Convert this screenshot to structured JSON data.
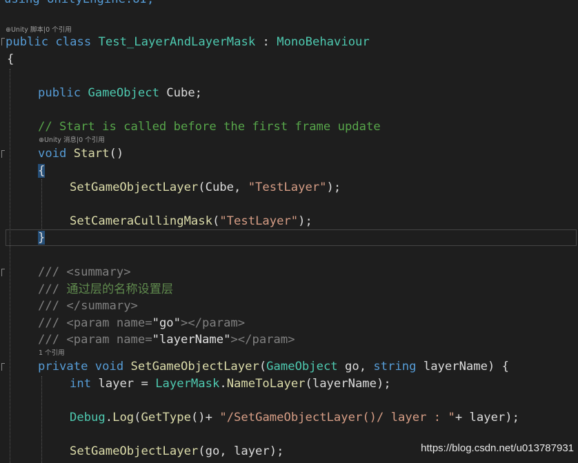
{
  "code": {
    "l0": "using UnityEngine.UI;",
    "lens_class": "Unity 脚本|0 个引用",
    "class_kw": "public class ",
    "class_name": "Test_LayerAndLayerMask",
    "class_colon": " : ",
    "base_class": "MonoBehaviour",
    "open_brace": "{",
    "field_kw": "public ",
    "field_type": "GameObject",
    "field_name": " Cube;",
    "comment_start": "// Start is called before the first frame update",
    "lens_start": "Unity 消息|0 个引用",
    "start_void": "void ",
    "start_name": "Start",
    "start_parens": "()",
    "start_open": "{",
    "call1_fn": "SetGameObjectLayer",
    "call1_a": "(Cube, ",
    "call1_str": "\"TestLayer\"",
    "call1_end": ");",
    "call2_fn": "SetCameraCullingMask",
    "call2_a": "(",
    "call2_str": "\"TestLayer\"",
    "call2_end": ");",
    "start_close": "}",
    "doc1_slashes": "/// ",
    "doc1_tag": "<summary>",
    "doc2_slashes": "/// ",
    "doc2_text": "通过层的名称设置层",
    "doc3_slashes": "/// ",
    "doc3_tag": "</summary>",
    "doc4_slashes": "/// ",
    "doc4_open": "<param ",
    "doc4_attr": "name=",
    "doc4_val": "\"go\"",
    "doc4_close": "></param>",
    "doc5_slashes": "/// ",
    "doc5_open": "<param ",
    "doc5_attr": "name=",
    "doc5_val": "\"layerName\"",
    "doc5_close": "></param>",
    "lens_method": "1 个引用",
    "m_private": "private ",
    "m_void": "void ",
    "m_name": "SetGameObjectLayer",
    "m_paren": "(",
    "m_type1": "GameObject",
    "m_arg1": " go, ",
    "m_type2": "string",
    "m_arg2": " layerName) {",
    "int_kw": "int",
    "int_rest": " layer = ",
    "lm_type": "LayerMask",
    "lm_dot": ".",
    "lm_fn": "NameToLayer",
    "lm_end": "(layerName);",
    "dbg_type": "Debug",
    "dbg_dot": ".",
    "dbg_fn": "Log",
    "dbg_p": "(",
    "dbg_fn2": "GetType",
    "dbg_mid": "()+ ",
    "dbg_str": "\"/SetGameObjectLayer()/ layer : \"",
    "dbg_end": "+ layer);",
    "rec_fn": "SetGameObjectLayer",
    "rec_end": "(go, layer);"
  },
  "watermark": "https://blog.csdn.net/u013787931",
  "colors": {
    "background": "#1e1e1e",
    "keyword": "#569cd6",
    "type": "#4ec9b0",
    "comment": "#57a64a",
    "string": "#d69d85",
    "method": "#dcdcaa"
  }
}
